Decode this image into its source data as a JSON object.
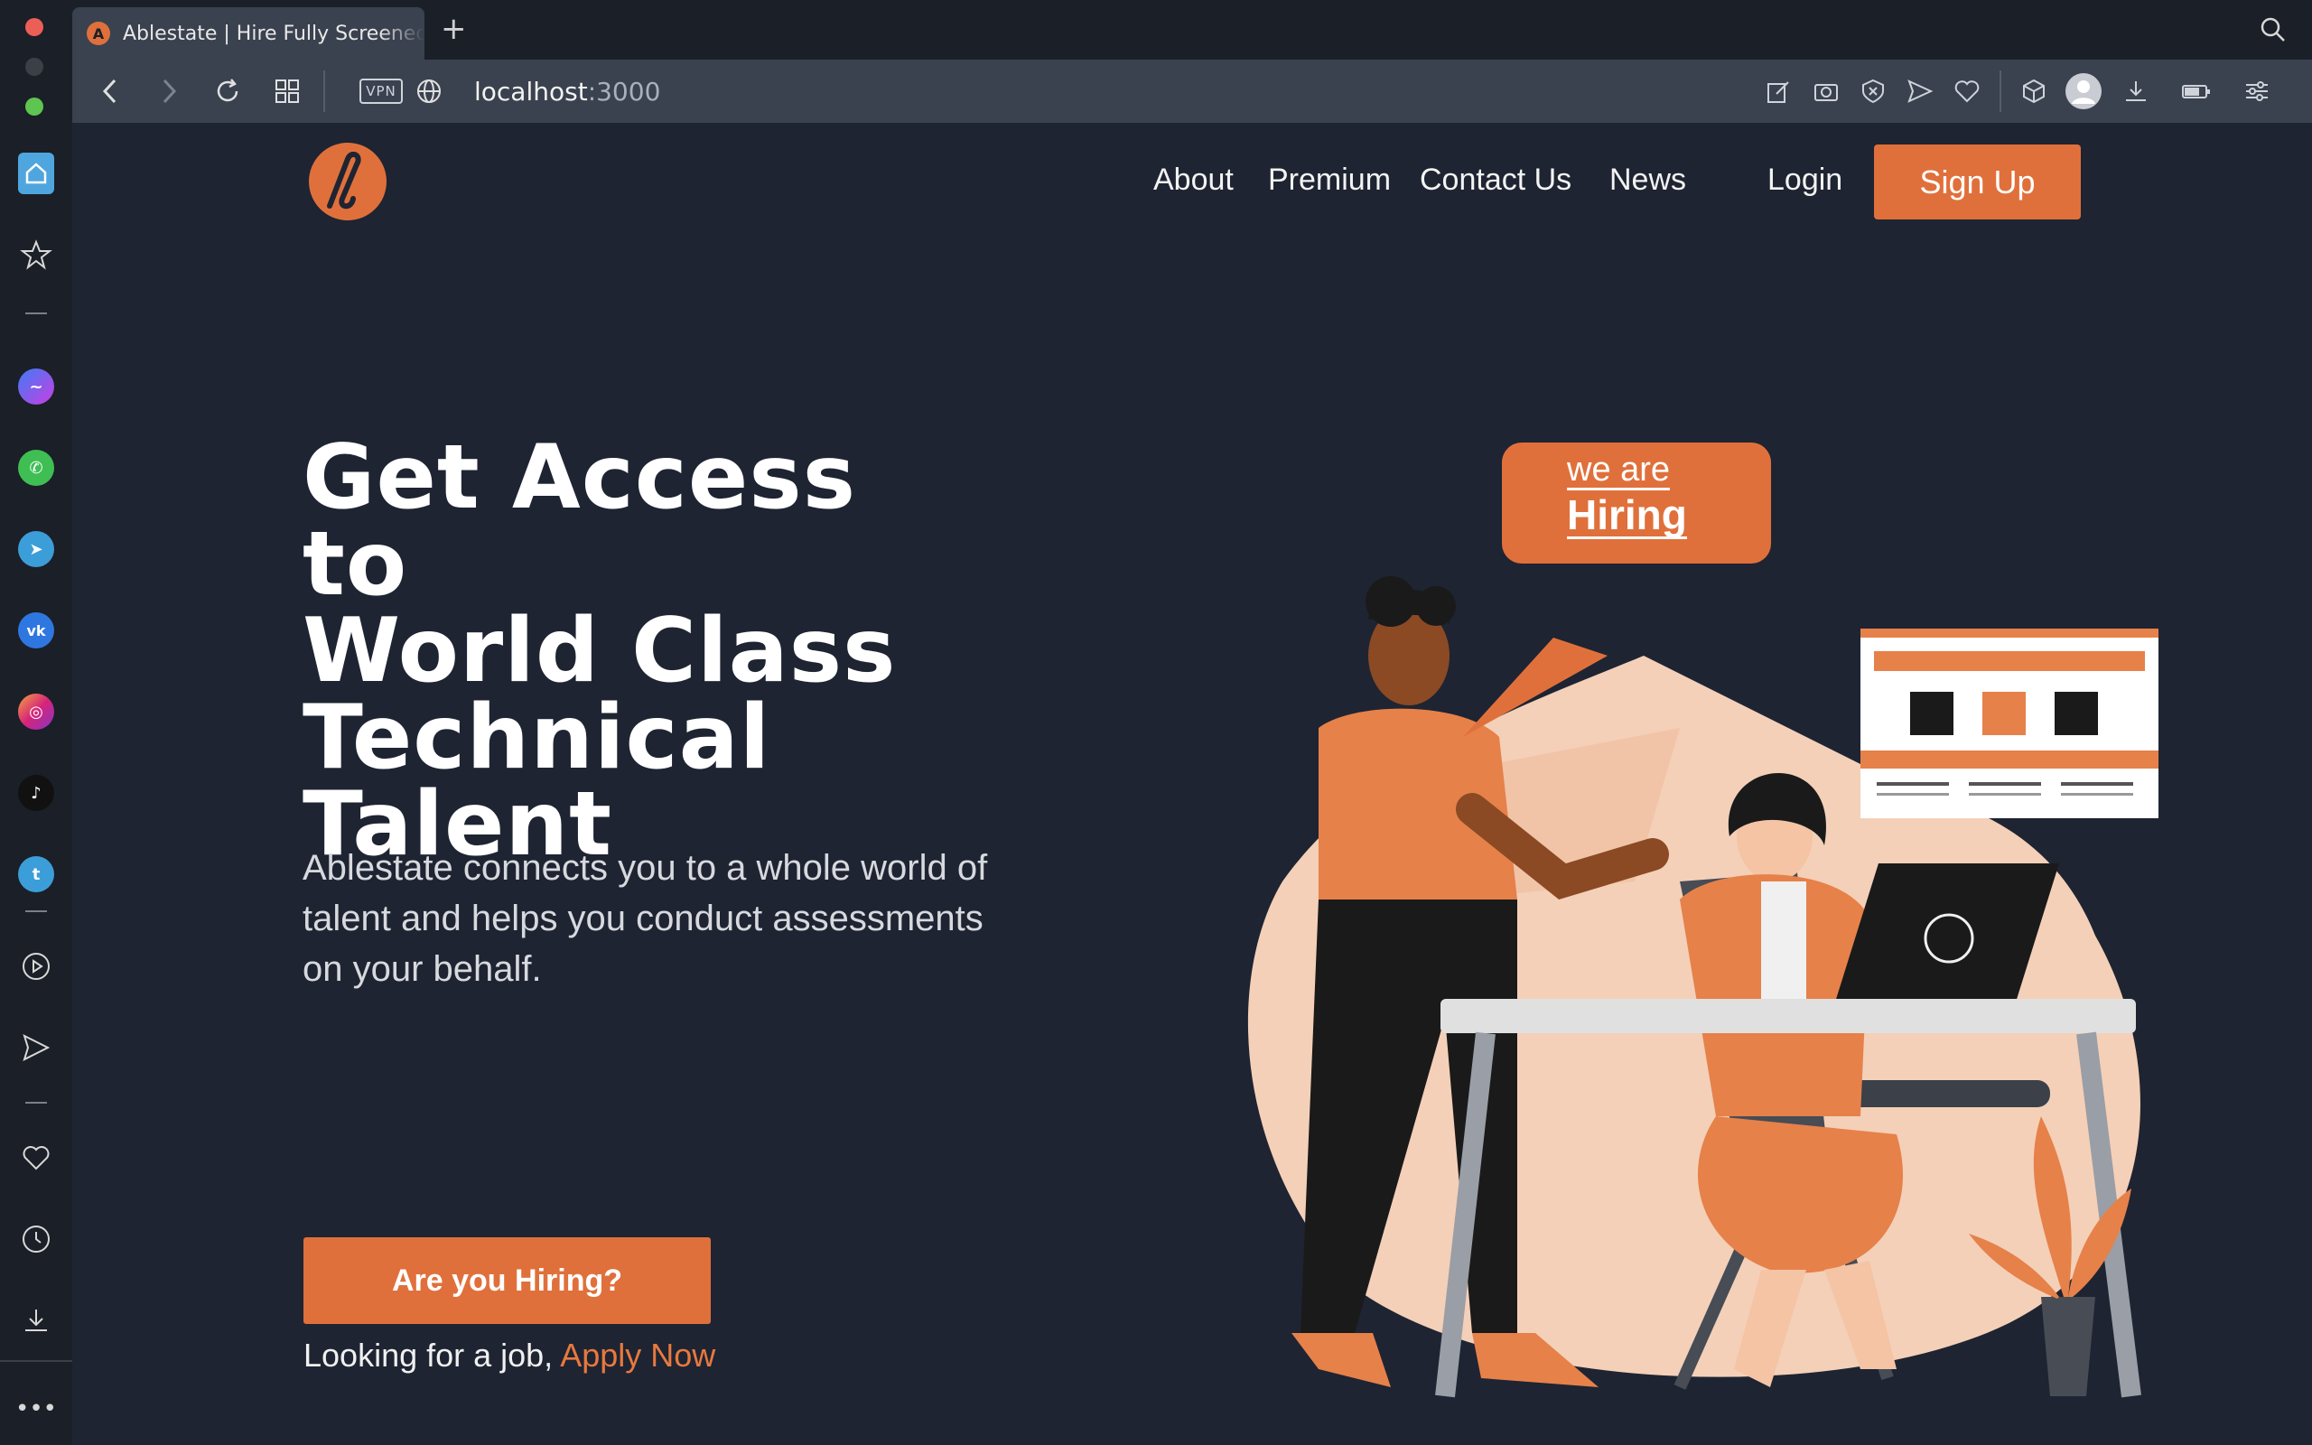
{
  "browser": {
    "tab_title": "Ablestate | Hire Fully Screened Developers",
    "new_tab_label": "+",
    "vpn_label": "VPN",
    "url_host": "localhost",
    "url_port": ":3000"
  },
  "colors": {
    "accent": "#e0703b",
    "page_bg": "#1e2432",
    "chrome_bg": "#1b1f27",
    "addressbar_bg": "#3a424f"
  },
  "sidebar_icons": [
    "home-icon",
    "star-icon",
    "messenger-icon",
    "whatsapp-icon",
    "telegram-icon",
    "vk-icon",
    "instagram-icon",
    "tiktok-icon",
    "twitter-icon",
    "player-icon",
    "send-icon",
    "heart-icon",
    "clock-icon",
    "download-icon",
    "more-icon"
  ],
  "nav": {
    "about": "About",
    "premium": "Premium",
    "contact": "Contact Us",
    "news": "News",
    "login": "Login",
    "signup": "Sign Up"
  },
  "hero": {
    "line1": "Get Access to",
    "line2": "World Class",
    "line3": "Technical",
    "line4": "Talent",
    "subtitle": "Ablestate connects you to a whole world of talent and helps you conduct assessments on your behalf.",
    "cta": "Are you Hiring?",
    "job_prefix": "Looking for a job, ",
    "job_link": "Apply Now"
  },
  "illustration": {
    "bubble_line1": "we are",
    "bubble_line2": "Hiring"
  }
}
